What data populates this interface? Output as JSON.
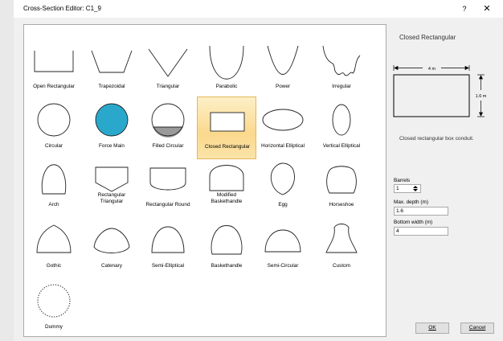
{
  "window": {
    "title": "Cross-Section Editor: C1_9",
    "help_label": "?",
    "close_label": "✕"
  },
  "shapes": [
    "Open Rectangular",
    "Trapezoidal",
    "Triangular",
    "Parabolic",
    "Power",
    "Irregular",
    "Circular",
    "Force Main",
    "Filled Circular",
    "Closed Rectangular",
    "Horizontal Elliptical",
    "Vertical Elliptical",
    "Arch",
    "Rectangular\nTriangular",
    "Rectangular Round",
    "Modified\nBaskethandle",
    "Egg",
    "Horseshoe",
    "Gothic",
    "Catenary",
    "Semi-Elliptical",
    "Baskethandle",
    "Semi-Circular",
    "Custom",
    "Dummy"
  ],
  "selected_shape": "Closed Rectangular",
  "side": {
    "title": "Closed Rectangular",
    "width_dim": "4 m",
    "height_dim": "1.6 m",
    "description": "Closed rectangular box conduit."
  },
  "params": {
    "barrels_label": "Barrels",
    "barrels_value": "1",
    "max_depth_label": "Max. depth (m)",
    "max_depth_value": "1.6",
    "bottom_width_label": "Bottom width (m)",
    "bottom_width_value": "4"
  },
  "buttons": {
    "ok": "OK",
    "cancel": "Cancel"
  },
  "colors": {
    "force_main_fill": "#2aa8cc",
    "selected_bg": "#fbd98d",
    "filled_circular_fill": "#9a9a9a"
  }
}
